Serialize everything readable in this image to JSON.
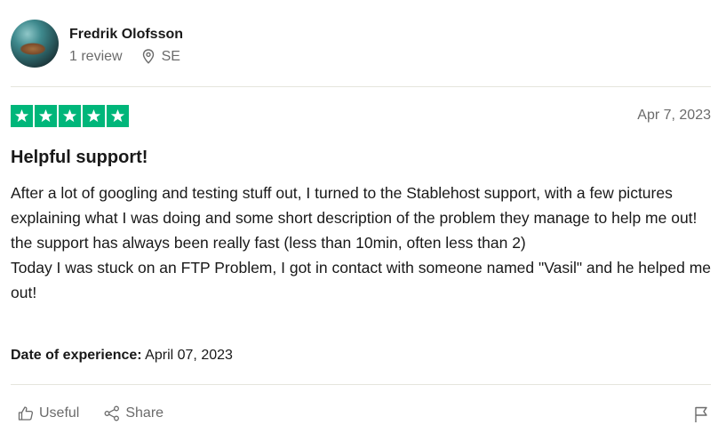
{
  "reviewer": {
    "name": "Fredrik Olofsson",
    "reviews": "1 review",
    "location": "SE"
  },
  "rating": {
    "stars": 5,
    "max": 5,
    "color": "#00b67a"
  },
  "review": {
    "date": "Apr 7, 2023",
    "title": "Helpful support!",
    "paragraph1": "After a lot of googling and testing stuff out, I turned to the Stablehost support, with a few pictures explaining what I was doing and some short description of the problem they manage to help me out! the support has always been really fast (less than 10min, often less than 2)",
    "paragraph2": "Today I was stuck on an FTP Problem, I got in contact with someone named \"Vasil\" and he helped me out!",
    "experience_label": "Date of experience:",
    "experience_date": "April 07, 2023"
  },
  "actions": {
    "useful_label": "Useful",
    "share_label": "Share"
  },
  "icons": {
    "location": "location-pin-icon",
    "useful": "thumbs-up-icon",
    "share": "share-icon",
    "report": "flag-icon"
  }
}
